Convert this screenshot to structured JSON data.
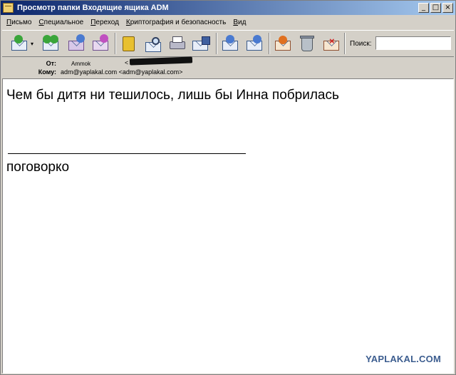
{
  "window": {
    "title": "Просмотр папки Входящие ящика ADM",
    "controls": [
      "_",
      "□",
      "×"
    ]
  },
  "menu": [
    "Письмо",
    "Специальное",
    "Переход",
    "Криптография и безопасность",
    "Вид"
  ],
  "toolbar": {
    "icons": [
      "get-mail-icon",
      "send-receive-icon",
      "reply-icon",
      "forward-icon",
      "address-book-icon",
      "find-icon",
      "print-icon",
      "save-icon",
      "previous-message-icon",
      "next-message-icon",
      "mark-icon",
      "delete-icon",
      "junk-icon"
    ],
    "search_label": "Поиск:",
    "search_value": ""
  },
  "header": {
    "from_label": "От:",
    "from_name": "Ammok",
    "from_bracket": "<",
    "to_label": "Кому:",
    "to_value": "adm@yaplakal.com <adm@yaplakal.com>"
  },
  "message": {
    "body": "Чем бы дитя ни тешилось, лишь бы Инна побрилась",
    "signature": "поговорко"
  },
  "watermark": "YAPLAKAL.COM",
  "colors": {
    "title_start": "#0a246a",
    "title_end": "#a6caf0",
    "chrome": "#d4d0c8",
    "watermark": "#3c5d8f"
  }
}
